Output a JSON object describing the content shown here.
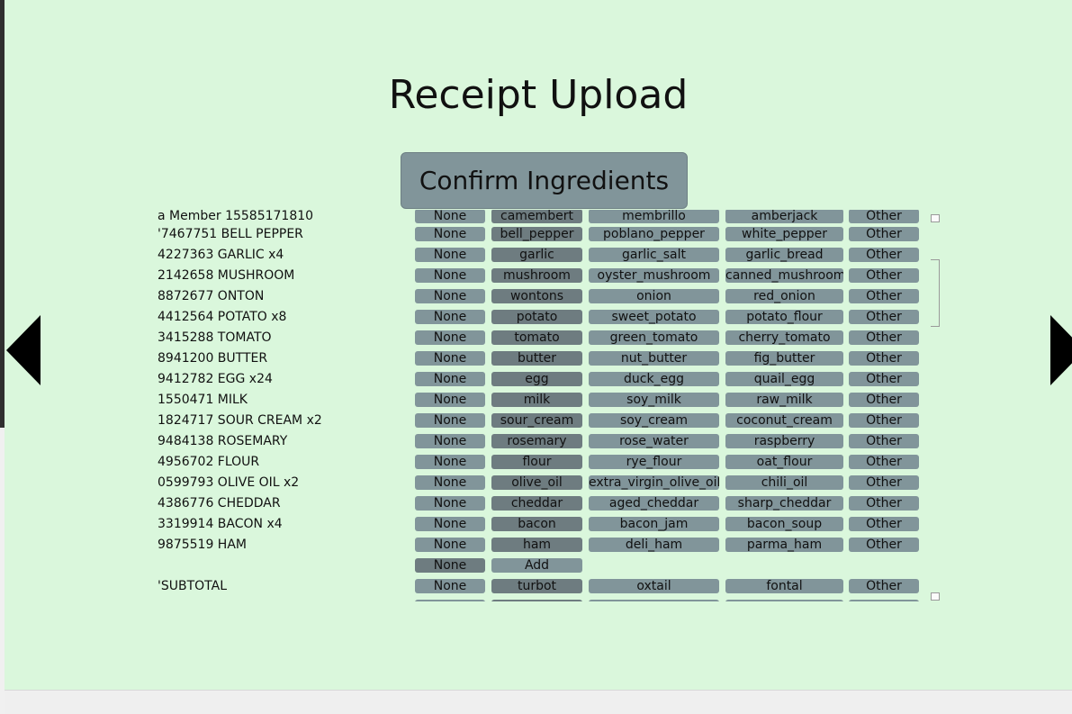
{
  "title": "Receipt Upload",
  "confirm_label": "Confirm Ingredients",
  "partial_top": {
    "receipt": "a Member 15585171810",
    "none": "None",
    "main": "camembert",
    "s1": "membrillo",
    "s2": "amberjack",
    "other": "Other"
  },
  "rows": [
    {
      "receipt": "'7467751 BELL PEPPER",
      "none": "None",
      "main": "bell_pepper",
      "s1": "poblano_pepper",
      "s2": "white_pepper",
      "other": "Other"
    },
    {
      "receipt": "4227363 GARLIC x4",
      "none": "None",
      "main": "garlic",
      "s1": "garlic_salt",
      "s2": "garlic_bread",
      "other": "Other"
    },
    {
      "receipt": "2142658 MUSHROOM",
      "none": "None",
      "main": "mushroom",
      "s1": "oyster_mushroom",
      "s2": "canned_mushroom",
      "other": "Other"
    },
    {
      "receipt": "8872677 ONTON",
      "none": "None",
      "main": "wontons",
      "s1": "onion",
      "s2": "red_onion",
      "other": "Other"
    },
    {
      "receipt": "4412564 POTATO x8",
      "none": "None",
      "main": "potato",
      "s1": "sweet_potato",
      "s2": "potato_flour",
      "other": "Other"
    },
    {
      "receipt": "3415288 TOMATO",
      "none": "None",
      "main": "tomato",
      "s1": "green_tomato",
      "s2": "cherry_tomato",
      "other": "Other"
    },
    {
      "receipt": "8941200 BUTTER",
      "none": "None",
      "main": "butter",
      "s1": "nut_butter",
      "s2": "fig_butter",
      "other": "Other"
    },
    {
      "receipt": "9412782 EGG x24",
      "none": "None",
      "main": "egg",
      "s1": "duck_egg",
      "s2": "quail_egg",
      "other": "Other"
    },
    {
      "receipt": "1550471 MILK",
      "none": "None",
      "main": "milk",
      "s1": "soy_milk",
      "s2": "raw_milk",
      "other": "Other"
    },
    {
      "receipt": "1824717 SOUR CREAM x2",
      "none": "None",
      "main": "sour_cream",
      "s1": "soy_cream",
      "s2": "coconut_cream",
      "other": "Other"
    },
    {
      "receipt": "9484138 ROSEMARY",
      "none": "None",
      "main": "rosemary",
      "s1": "rose_water",
      "s2": "raspberry",
      "other": "Other"
    },
    {
      "receipt": "4956702 FLOUR",
      "none": "None",
      "main": "flour",
      "s1": "rye_flour",
      "s2": "oat_flour",
      "other": "Other"
    },
    {
      "receipt": "0599793 OLIVE OIL x2",
      "none": "None",
      "main": "olive_oil",
      "s1": "extra_virgin_olive_oil",
      "s2": "chili_oil",
      "other": "Other"
    },
    {
      "receipt": "4386776 CHEDDAR",
      "none": "None",
      "main": "cheddar",
      "s1": "aged_cheddar",
      "s2": "sharp_cheddar",
      "other": "Other"
    },
    {
      "receipt": "3319914 BACON x4",
      "none": "None",
      "main": "bacon",
      "s1": "bacon_jam",
      "s2": "bacon_soup",
      "other": "Other"
    },
    {
      "receipt": "9875519 HAM",
      "none": "None",
      "main": "ham",
      "s1": "deli_ham",
      "s2": "parma_ham",
      "other": "Other"
    }
  ],
  "add_row": {
    "none": "None",
    "add": "Add"
  },
  "subtotal_row": {
    "receipt": "'SUBTOTAL",
    "none": "None",
    "main": "turbot",
    "s1": "oxtail",
    "s2": "fontal",
    "other": "Other"
  }
}
